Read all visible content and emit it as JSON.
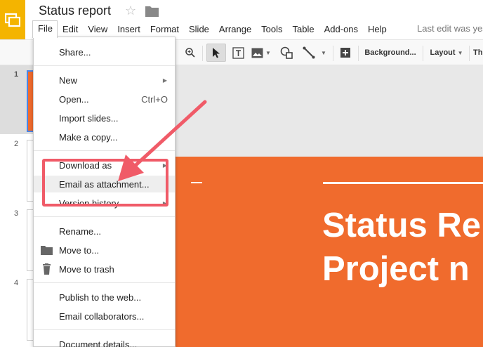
{
  "app": {
    "title": "Status report",
    "logo_icon": "slides-logo-icon",
    "star_icon": "star-outline-icon",
    "folder_icon": "folder-icon",
    "last_edit": "Last edit was yes"
  },
  "menubar": {
    "items": [
      "File",
      "Edit",
      "View",
      "Insert",
      "Format",
      "Slide",
      "Arrange",
      "Tools",
      "Table",
      "Add-ons",
      "Help"
    ]
  },
  "toolbar": {
    "background_label": "Background...",
    "layout_label": "Layout",
    "theme_label": "Th"
  },
  "file_menu": {
    "share": "Share...",
    "new": "New",
    "open": "Open...",
    "open_shortcut": "Ctrl+O",
    "import_slides": "Import slides...",
    "make_copy": "Make a copy...",
    "download_as": "Download as",
    "email_attachment": "Email as attachment...",
    "version_history": "Version history",
    "rename": "Rename...",
    "move_to": "Move to...",
    "move_to_trash": "Move to trash",
    "publish": "Publish to the web...",
    "email_collaborators": "Email collaborators...",
    "document_details": "Document details..."
  },
  "filmstrip": {
    "slide_numbers": [
      "1",
      "2",
      "3",
      "4"
    ]
  },
  "slide": {
    "title_line1": "Status Re",
    "title_line2": "Project n",
    "background_color": "#f06b2d"
  },
  "annotation": {
    "color": "#f05b68"
  }
}
